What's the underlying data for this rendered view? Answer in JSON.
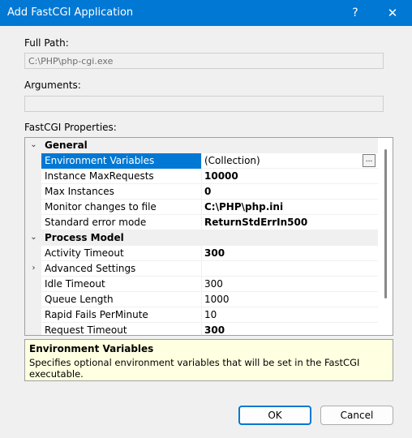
{
  "window": {
    "title": "Add FastCGI Application",
    "help_glyph": "?",
    "close_glyph": "✕"
  },
  "full_path": {
    "label": "Full Path:",
    "value": "C:\\PHP\\php-cgi.exe"
  },
  "arguments": {
    "label": "Arguments:",
    "value": ""
  },
  "properties": {
    "label": "FastCGI Properties:",
    "rows": [
      {
        "kind": "category",
        "name": "General",
        "glyph": "⌄"
      },
      {
        "kind": "prop",
        "name": "Environment Variables",
        "value": "(Collection)",
        "bold": false,
        "selected": true,
        "ellipsis": "..."
      },
      {
        "kind": "prop",
        "name": "Instance MaxRequests",
        "value": "10000",
        "bold": true
      },
      {
        "kind": "prop",
        "name": "Max Instances",
        "value": "0",
        "bold": true
      },
      {
        "kind": "prop",
        "name": "Monitor changes to file",
        "value": "C:\\PHP\\php.ini",
        "bold": true
      },
      {
        "kind": "prop",
        "name": "Standard error mode",
        "value": "ReturnStdErrIn500",
        "bold": true
      },
      {
        "kind": "category",
        "name": "Process Model",
        "glyph": "⌄"
      },
      {
        "kind": "prop",
        "name": "Activity Timeout",
        "value": "300",
        "bold": true
      },
      {
        "kind": "prop",
        "name": "Advanced Settings",
        "value": "",
        "bold": false,
        "expander": "›"
      },
      {
        "kind": "prop",
        "name": "Idle Timeout",
        "value": "300",
        "bold": false
      },
      {
        "kind": "prop",
        "name": "Queue Length",
        "value": "1000",
        "bold": false
      },
      {
        "kind": "prop",
        "name": "Rapid Fails PerMinute",
        "value": "10",
        "bold": false
      },
      {
        "kind": "prop",
        "name": "Request Timeout",
        "value": "300",
        "bold": true
      }
    ]
  },
  "help": {
    "title": "Environment Variables",
    "description": "Specifies optional environment variables that will be set in the FastCGI executable."
  },
  "buttons": {
    "ok": "OK",
    "cancel": "Cancel"
  },
  "colors": {
    "titlebar": "#0078d4",
    "selection": "#0078d4",
    "help_background": "#ffffe1"
  }
}
